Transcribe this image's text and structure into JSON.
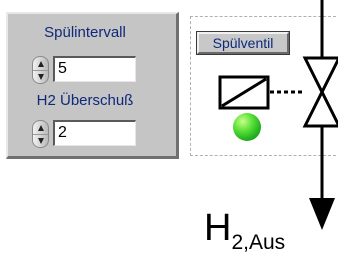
{
  "controls": {
    "interval": {
      "label": "Spülintervall",
      "value": "5"
    },
    "excess": {
      "label": "H2 Überschuß",
      "value": "2"
    }
  },
  "valve": {
    "button_label": "Spülventil",
    "led_color": "#33cc22"
  },
  "outlet": {
    "label_main": "H",
    "label_sub": "2,Aus"
  },
  "colors": {
    "label_text": "#0d2a7a",
    "panel_bg": "#c5c5c5",
    "line": "#000000"
  },
  "icons": [
    "spinner-up-icon",
    "spinner-down-icon",
    "solenoid-icon",
    "valve-icon",
    "arrow-down-icon"
  ]
}
